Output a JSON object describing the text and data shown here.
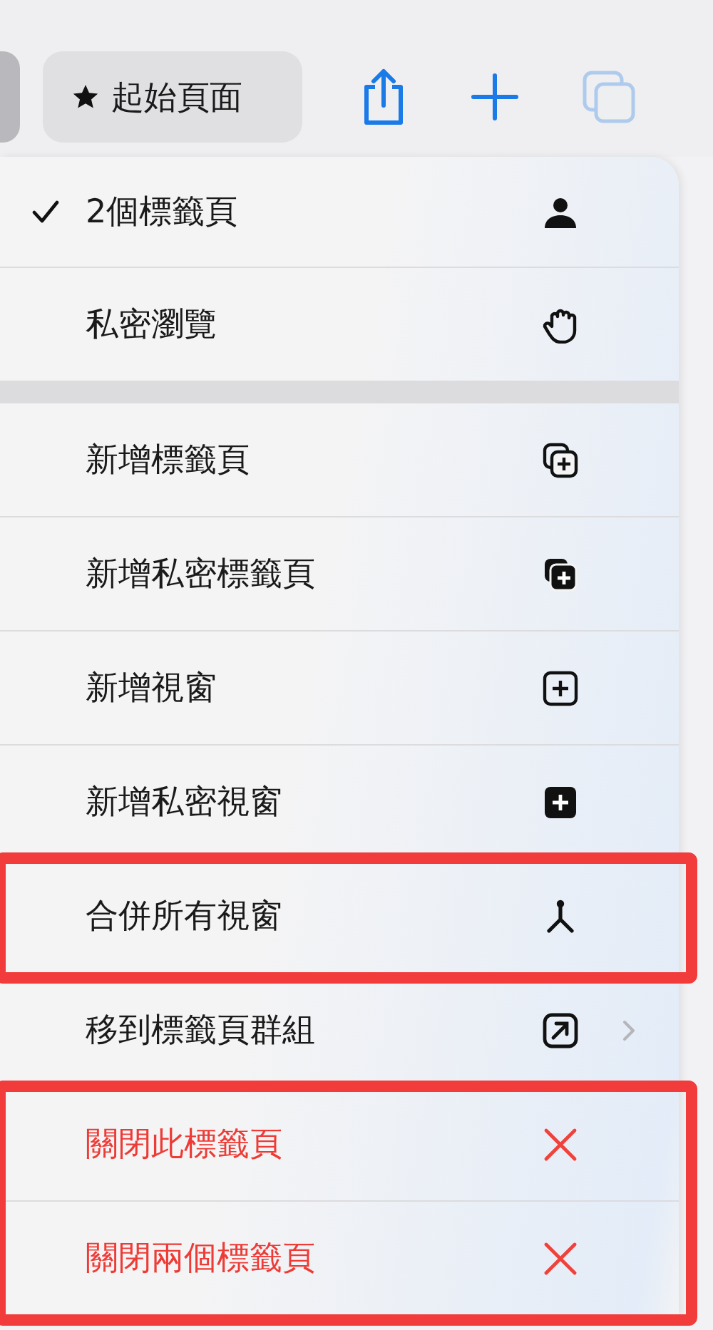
{
  "toolbar": {
    "start_page": {
      "label": "起始頁面"
    },
    "tabs_button": {
      "disabled": true
    }
  },
  "menu": {
    "sections": [
      {
        "items": [
          {
            "label": "2個標籤頁",
            "checked": true,
            "kind": "normal",
            "submenu": false,
            "highlighted": false
          },
          {
            "label": "私密瀏覽",
            "checked": false,
            "kind": "normal",
            "submenu": false,
            "highlighted": false
          }
        ]
      },
      {
        "items": [
          {
            "label": "新增標籤頁",
            "checked": false,
            "kind": "normal",
            "submenu": false,
            "highlighted": false
          },
          {
            "label": "新增私密標籤頁",
            "checked": false,
            "kind": "normal",
            "submenu": false,
            "highlighted": false
          },
          {
            "label": "新增視窗",
            "checked": false,
            "kind": "normal",
            "submenu": false,
            "highlighted": false
          },
          {
            "label": "新增私密視窗",
            "checked": false,
            "kind": "normal",
            "submenu": false,
            "highlighted": false
          },
          {
            "label": "合併所有視窗",
            "checked": false,
            "kind": "normal",
            "submenu": false,
            "highlighted": true
          },
          {
            "label": "移到標籤頁群組",
            "checked": false,
            "kind": "normal",
            "submenu": true,
            "highlighted": false
          },
          {
            "label": "關閉此標籤頁",
            "checked": false,
            "kind": "destructive",
            "submenu": false,
            "highlighted": true
          },
          {
            "label": "關閉兩個標籤頁",
            "checked": false,
            "kind": "destructive",
            "submenu": false,
            "highlighted": true
          }
        ]
      }
    ]
  }
}
